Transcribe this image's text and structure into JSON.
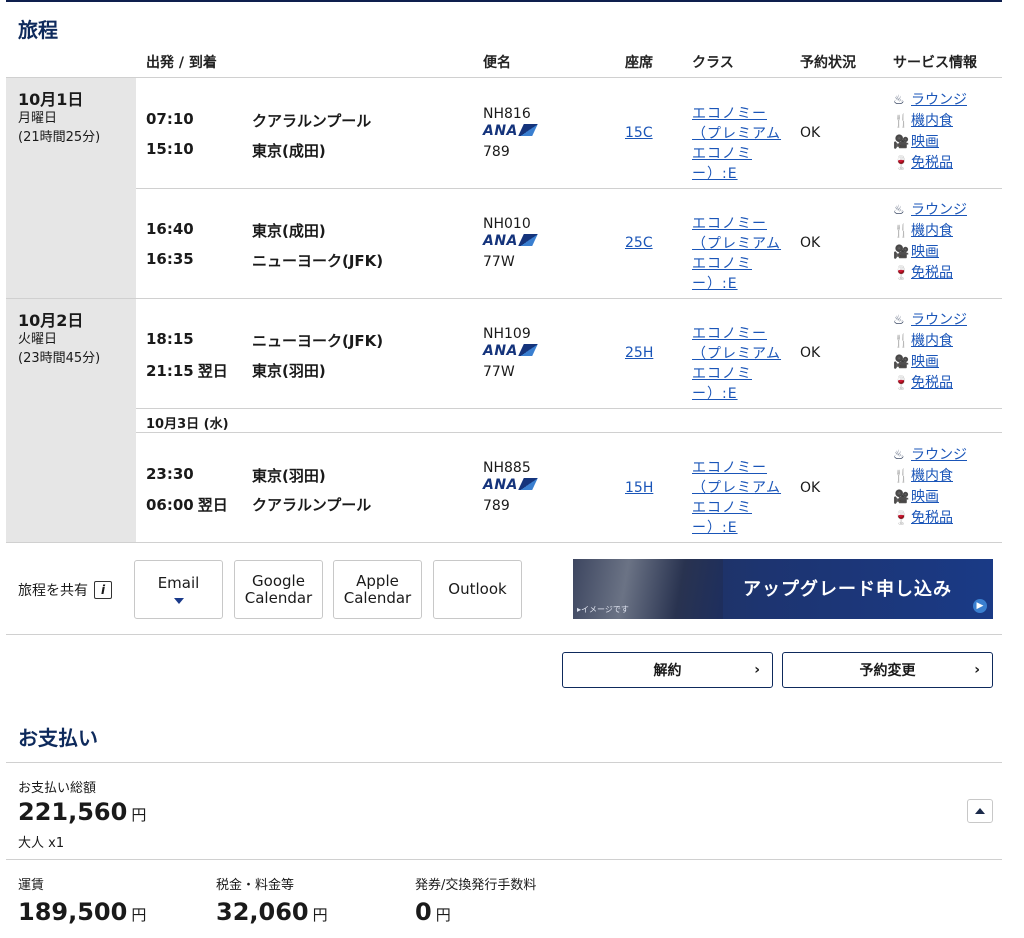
{
  "itinerary": {
    "title": "旅程",
    "headers": {
      "depart_arrive": "出発 / 到着",
      "flight": "便名",
      "seat": "座席",
      "class": "クラス",
      "status": "予約状況",
      "service": "サービス情報"
    },
    "days": [
      {
        "date": "10月1日",
        "weekday": "月曜日",
        "duration": "(21時間25分)"
      },
      {
        "date": "10月2日",
        "weekday": "火曜日",
        "duration": "(23時間45分)"
      }
    ],
    "segments": [
      {
        "dep_time": "07:10",
        "dep_suffix": "",
        "dep_city": "クアラルンプール",
        "arr_time": "15:10",
        "arr_suffix": "",
        "arr_city": "東京(成田)",
        "flight_no": "NH816",
        "airline": "ANA",
        "aircraft": "789",
        "seat": "15C",
        "class": "エコノミー（プレミアムエコノミー）:E",
        "status": "OK"
      },
      {
        "dep_time": "16:40",
        "dep_suffix": "",
        "dep_city": "東京(成田)",
        "arr_time": "16:35",
        "arr_suffix": "",
        "arr_city": "ニューヨーク(JFK)",
        "flight_no": "NH010",
        "airline": "ANA",
        "aircraft": "77W",
        "seat": "25C",
        "class": "エコノミー（プレミアムエコノミー）:E",
        "status": "OK"
      },
      {
        "dep_time": "18:15",
        "dep_suffix": "",
        "dep_city": "ニューヨーク(JFK)",
        "arr_time": "21:15",
        "arr_suffix": "翌日",
        "arr_city": "東京(羽田)",
        "flight_no": "NH109",
        "airline": "ANA",
        "aircraft": "77W",
        "seat": "25H",
        "class": "エコノミー（プレミアムエコノミー）:E",
        "status": "OK"
      },
      {
        "dep_time": "23:30",
        "dep_suffix": "",
        "dep_city": "東京(羽田)",
        "arr_time": "06:00",
        "arr_suffix": "翌日",
        "arr_city": "クアラルンプール",
        "flight_no": "NH885",
        "airline": "ANA",
        "aircraft": "789",
        "seat": "15H",
        "class": "エコノミー（プレミアムエコノミー）:E",
        "status": "OK"
      }
    ],
    "sub_date": "10月3日 (水)",
    "services": {
      "lounge": "ラウンジ",
      "meal": "機内食",
      "movie": "映画",
      "dutyfree": "免税品"
    }
  },
  "share": {
    "label": "旅程を共有",
    "info_icon": "i",
    "email": "Email",
    "google": [
      "Google",
      "Calendar"
    ],
    "apple": [
      "Apple",
      "Calendar"
    ],
    "outlook": "Outlook"
  },
  "banner": {
    "text": "アップグレード申し込み",
    "tag": "▸イメージです"
  },
  "actions": {
    "cancel": "解約",
    "change": "予約変更"
  },
  "payment": {
    "title": "お支払い",
    "total_label": "お支払い総額",
    "total": "221,560",
    "yen": "円",
    "pax": "大人 x1",
    "fare_label": "運賃",
    "fare": "189,500",
    "tax_label": "税金・料金等",
    "tax": "32,060",
    "fee_label": "発券/交換発行手数料",
    "fee": "0"
  }
}
